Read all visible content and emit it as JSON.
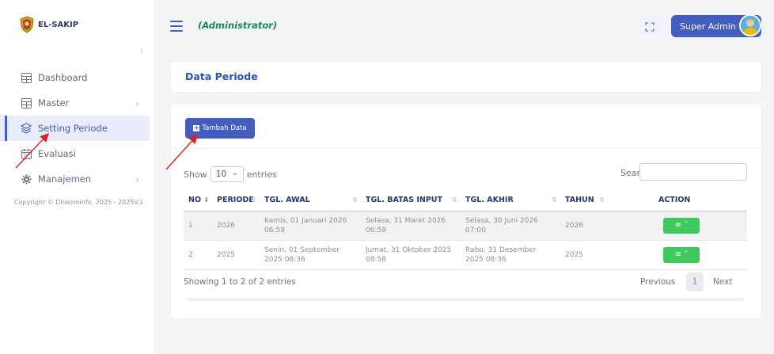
{
  "app": {
    "brand": "EL-SAKIP",
    "role": "(Administrator)"
  },
  "header": {
    "user_label": "Super Admin"
  },
  "sidebar": {
    "items": [
      {
        "label": "Dashboard",
        "icon": "grid-icon",
        "has_children": false,
        "active": false
      },
      {
        "label": "Master",
        "icon": "grid-icon",
        "has_children": true,
        "active": false
      },
      {
        "label": "Setting Periode",
        "icon": "stack-icon",
        "has_children": false,
        "active": true
      },
      {
        "label": "Evaluasi",
        "icon": "calendar-icon",
        "has_children": false,
        "active": false
      },
      {
        "label": "Manajemen",
        "icon": "gear-icon",
        "has_children": true,
        "active": false
      }
    ],
    "copyright": "Copyright © Dinkominfo. 2025 - 2025V.1"
  },
  "page": {
    "title": "Data Periode"
  },
  "toolbar": {
    "add_label": "Tambah Data"
  },
  "table_controls": {
    "show_label": "Show",
    "length_value": "10",
    "entries_label": "entries",
    "search_label": "Search:",
    "search_value": ""
  },
  "table": {
    "columns": [
      "NO",
      "PERIODE",
      "TGL. AWAL",
      "TGL. BATAS INPUT",
      "TGL. AKHIR",
      "TAHUN",
      "ACTION"
    ],
    "rows": [
      {
        "no": "1",
        "periode": "2026",
        "tgl_awal": "Kamis, 01 Januari 2026 06:59",
        "tgl_batas": "Selasa, 31 Maret 2026 06:59",
        "tgl_akhir": "Selasa, 30 Juni 2026 07:00",
        "tahun": "2026"
      },
      {
        "no": "2",
        "periode": "2025",
        "tgl_awal": "Senin, 01 September 2025 08:36",
        "tgl_batas": "Jumat, 31 Oktober 2025 08:58",
        "tgl_akhir": "Rabu, 31 Desember 2025 08:36",
        "tahun": "2025"
      }
    ]
  },
  "footer": {
    "info": "Showing 1 to 2 of 2 entries",
    "previous": "Previous",
    "page": "1",
    "next": "Next"
  },
  "colors": {
    "primary": "#435ebe",
    "success": "#3ec95c",
    "role_text": "#198754",
    "annotation": "#e02020"
  }
}
